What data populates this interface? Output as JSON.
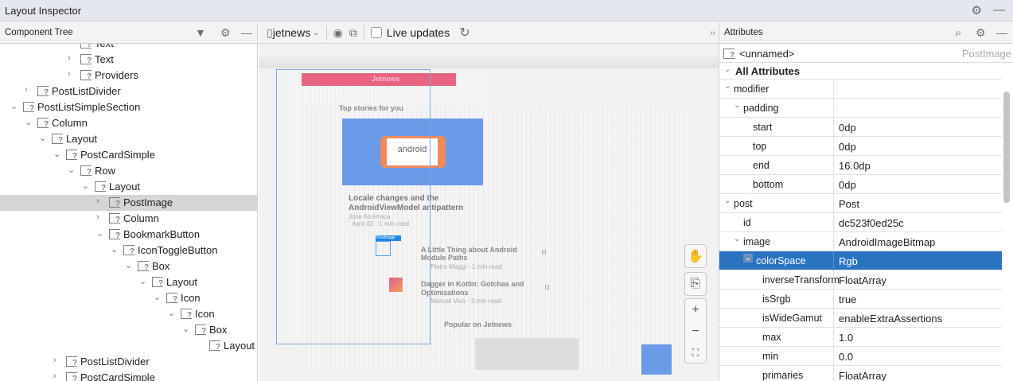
{
  "window": {
    "title": "Layout Inspector"
  },
  "component_tree": {
    "title": "Component Tree",
    "items": [
      {
        "label": "Text",
        "depth": 4,
        "expandable": true,
        "expanded": false
      },
      {
        "label": "Text",
        "depth": 4,
        "expandable": true,
        "expanded": false
      },
      {
        "label": "Providers",
        "depth": 4,
        "expandable": true,
        "expanded": false
      },
      {
        "label": "PostListDivider",
        "depth": 1,
        "expandable": true,
        "expanded": false
      },
      {
        "label": "PostListSimpleSection",
        "depth": 0,
        "expandable": true,
        "expanded": true
      },
      {
        "label": "Column",
        "depth": 1,
        "expandable": true,
        "expanded": true
      },
      {
        "label": "Layout",
        "depth": 2,
        "expandable": true,
        "expanded": true
      },
      {
        "label": "PostCardSimple",
        "depth": 3,
        "expandable": true,
        "expanded": true
      },
      {
        "label": "Row",
        "depth": 4,
        "expandable": true,
        "expanded": true
      },
      {
        "label": "Layout",
        "depth": 5,
        "expandable": true,
        "expanded": true
      },
      {
        "label": "PostImage",
        "depth": 6,
        "expandable": true,
        "expanded": false,
        "selected": true
      },
      {
        "label": "Column",
        "depth": 6,
        "expandable": true,
        "expanded": false
      },
      {
        "label": "BookmarkButton",
        "depth": 6,
        "expandable": true,
        "expanded": true
      },
      {
        "label": "IconToggleButton",
        "depth": 7,
        "expandable": true,
        "expanded": true
      },
      {
        "label": "Box",
        "depth": 8,
        "expandable": true,
        "expanded": true
      },
      {
        "label": "Layout",
        "depth": 9,
        "expandable": true,
        "expanded": true
      },
      {
        "label": "Icon",
        "depth": 10,
        "expandable": true,
        "expanded": true
      },
      {
        "label": "Icon",
        "depth": 11,
        "expandable": true,
        "expanded": true
      },
      {
        "label": "Box",
        "depth": 12,
        "expandable": true,
        "expanded": true
      },
      {
        "label": "Layout",
        "depth": 13,
        "expandable": false
      },
      {
        "label": "PostListDivider",
        "depth": 3,
        "expandable": true,
        "expanded": false
      },
      {
        "label": "PostCardSimple",
        "depth": 3,
        "expandable": true,
        "expanded": false
      }
    ]
  },
  "toolbar": {
    "process": "jetnews",
    "live_updates_label": "Live updates",
    "live_updates_checked": false
  },
  "preview": {
    "app_title": "Jetnews",
    "section1": "Top stories for you",
    "hero_title_1": "Locale changes and the",
    "hero_title_2": "AndroidViewModel antipattern",
    "hero_author": "Jose Alcérreca",
    "hero_meta": "April 02 - 1 min read",
    "selection_label": "PostImage",
    "post1_title_1": "A Little Thing about Android",
    "post1_title_2": "Module Paths",
    "post1_meta": "Pietro Maggi - 1 min read",
    "post2_title_1": "Dagger in Kotlin: Gotchas and",
    "post2_title_2": "Optimizations",
    "post2_meta": "Manuel Vivo - 3 min read",
    "section2": "Popular on Jetnews",
    "hero_image_text": "android",
    "accent": "#e8637f"
  },
  "attributes": {
    "title": "Attributes",
    "node_name": "<unnamed>",
    "node_type": "PostImage",
    "section": "All Attributes",
    "rows": [
      {
        "name": "modifier",
        "value": "",
        "depth": 0,
        "expanded": true
      },
      {
        "name": "padding",
        "value": "",
        "depth": 1,
        "expanded": true
      },
      {
        "name": "start",
        "value": "0dp",
        "depth": 2
      },
      {
        "name": "top",
        "value": "0dp",
        "depth": 2
      },
      {
        "name": "end",
        "value": "16.0dp",
        "depth": 2
      },
      {
        "name": "bottom",
        "value": "0dp",
        "depth": 2
      },
      {
        "name": "post",
        "value": "Post",
        "depth": 0,
        "expanded": true
      },
      {
        "name": "id",
        "value": "dc523f0ed25c",
        "depth": 1
      },
      {
        "name": "image",
        "value": "AndroidImageBitmap",
        "depth": 1,
        "expanded": true
      },
      {
        "name": "colorSpace",
        "value": "Rgb",
        "depth": 2,
        "expanded": true,
        "selected": true
      },
      {
        "name": "inverseTransform",
        "value": "FloatArray",
        "depth": 3
      },
      {
        "name": "isSrgb",
        "value": "true",
        "depth": 3
      },
      {
        "name": "isWideGamut",
        "value": "enableExtraAssertions",
        "depth": 3
      },
      {
        "name": "max",
        "value": "1.0",
        "depth": 3
      },
      {
        "name": "min",
        "value": "0.0",
        "depth": 3
      },
      {
        "name": "primaries",
        "value": "FloatArray",
        "depth": 3
      }
    ]
  },
  "colors": {
    "selection": "#2a73c0",
    "tree_selected": "#d5d5d5"
  }
}
